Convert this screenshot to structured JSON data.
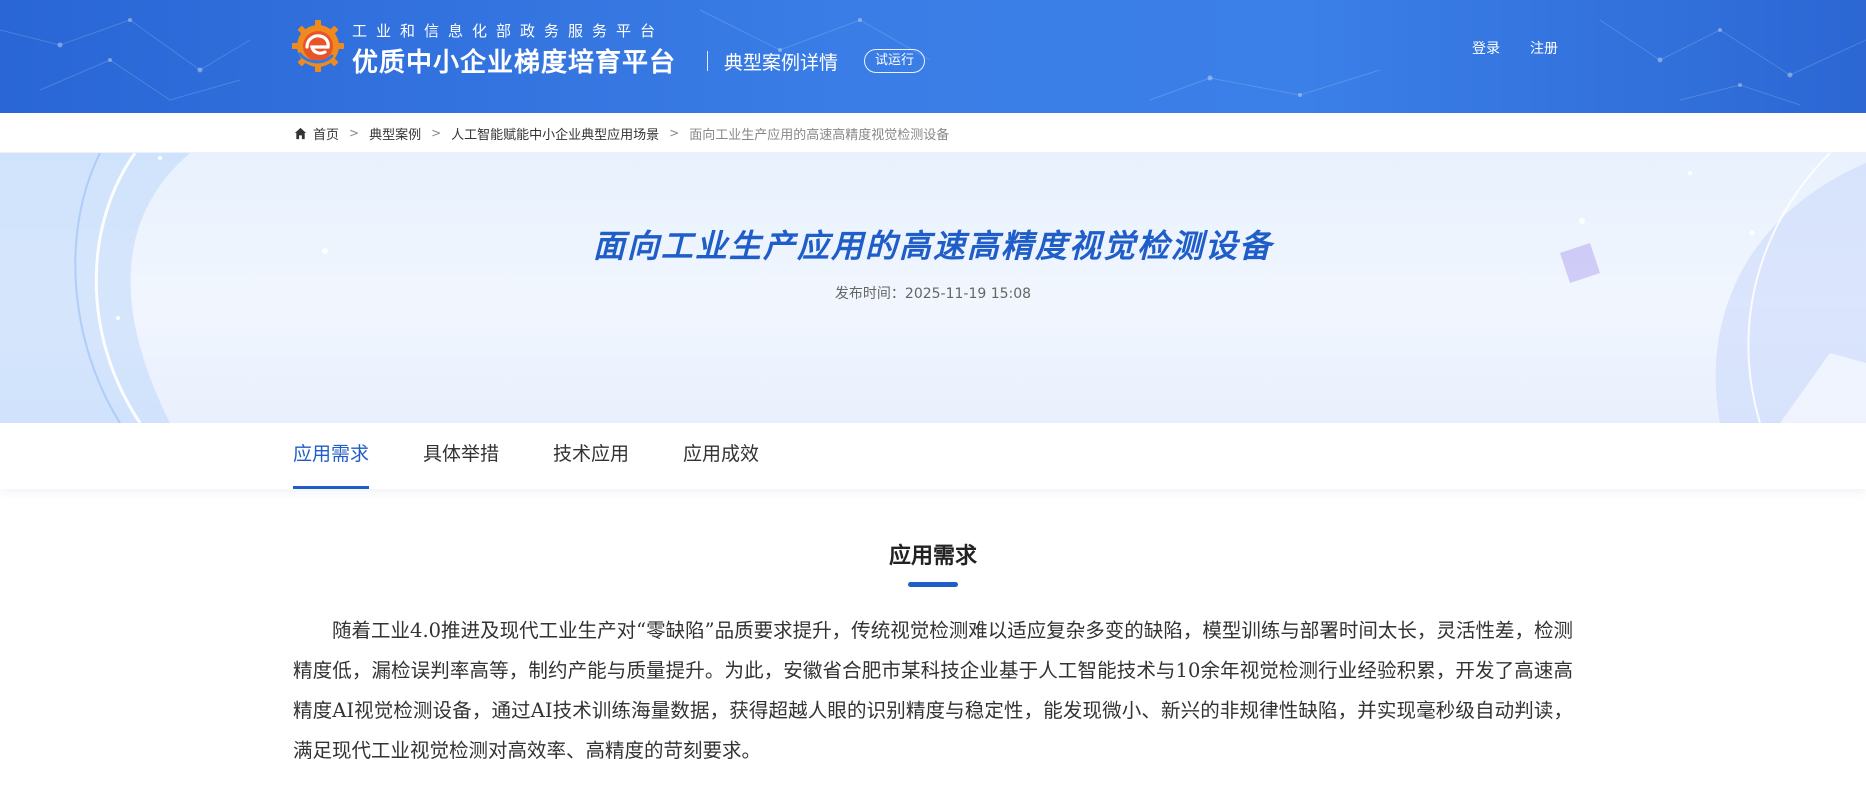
{
  "header": {
    "subtitle": "工业和信息化部政务服务平台",
    "title": "优质中小企业梯度培育平台",
    "page_name": "典型案例详情",
    "badge": "试运行",
    "login_label": "登录",
    "register_label": "注册"
  },
  "breadcrumb": {
    "items": [
      "首页",
      "典型案例",
      "人工智能赋能中小企业典型应用场景"
    ],
    "current": "面向工业生产应用的高速高精度视觉检测设备",
    "separator": ">"
  },
  "banner": {
    "title": "面向工业生产应用的高速高精度视觉检测设备",
    "publish_time": "发布时间：2025-11-19 15:08"
  },
  "tabs": [
    {
      "label": "应用需求",
      "active": true
    },
    {
      "label": "具体举措",
      "active": false
    },
    {
      "label": "技术应用",
      "active": false
    },
    {
      "label": "应用成效",
      "active": false
    }
  ],
  "section": {
    "title": "应用需求",
    "paragraph": "随着工业4.0推进及现代工业生产对“零缺陷”品质要求提升，传统视觉检测难以适应复杂多变的缺陷，模型训练与部署时间太长，灵活性差，检测精度低，漏检误判率高等，制约产能与质量提升。为此，安徽省合肥市某科技企业基于人工智能技术与10余年视觉检测行业经验积累，开发了高速高精度AI视觉检测设备，通过AI技术训练海量数据，获得超越人眼的识别精度与稳定性，能发现微小、新兴的非规律性缺陷，并实现毫秒级自动判读，满足现代工业视觉检测对高效率、高精度的苛刻要求。"
  },
  "colors": {
    "primary": "#1f5ec8",
    "header_blue": "#3a7de6",
    "banner_bg": "#eef4fd"
  },
  "icons": {
    "logo": "gear-e-logo-icon",
    "home": "home-icon"
  }
}
